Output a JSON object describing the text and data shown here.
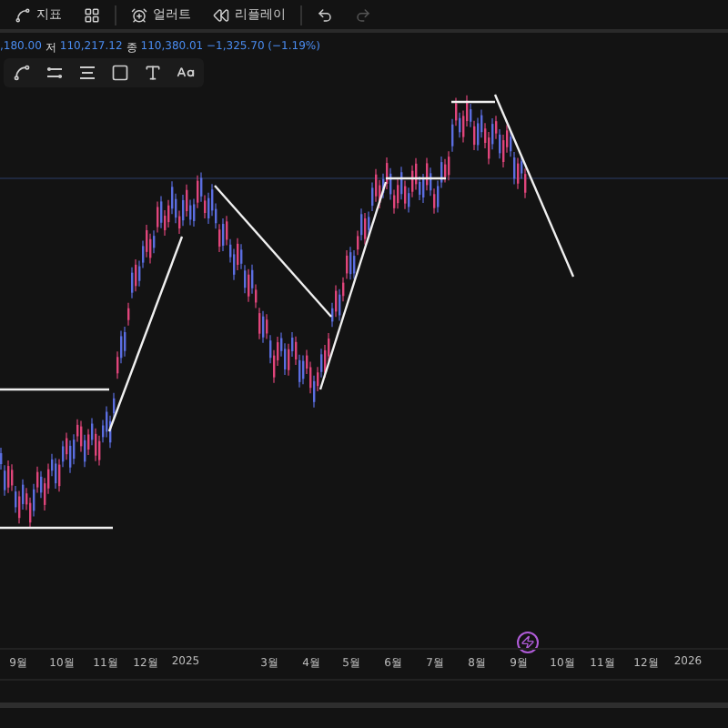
{
  "toolbar": [
    {
      "kind": "indicators",
      "label": "지표"
    },
    {
      "kind": "templates"
    },
    {
      "kind": "alert",
      "label": "얼러트"
    },
    {
      "kind": "replay",
      "label": "리플레이"
    },
    {
      "kind": "undo"
    },
    {
      "kind": "redo",
      "disabled": true
    }
  ],
  "legend": [
    {
      "kind": "value",
      "text": ",180.00"
    },
    {
      "kind": "label",
      "text": "저"
    },
    {
      "kind": "value",
      "text": "110,217.12"
    },
    {
      "kind": "label",
      "text": "종"
    },
    {
      "kind": "value",
      "text": "110,380.01 −1,325.70 (−1.19%)"
    }
  ],
  "drawing_tools": [
    {
      "kind": "trend"
    },
    {
      "kind": "channel"
    },
    {
      "kind": "range"
    },
    {
      "kind": "rectangle"
    },
    {
      "kind": "text"
    },
    {
      "kind": "text-note"
    }
  ],
  "time_axis": [
    "9월",
    "10월",
    "11월",
    "12월",
    "2025",
    "3월",
    "4월",
    "5월",
    "6월",
    "7월",
    "8월",
    "9월",
    "10월",
    "11월",
    "12월",
    "2026"
  ]
}
